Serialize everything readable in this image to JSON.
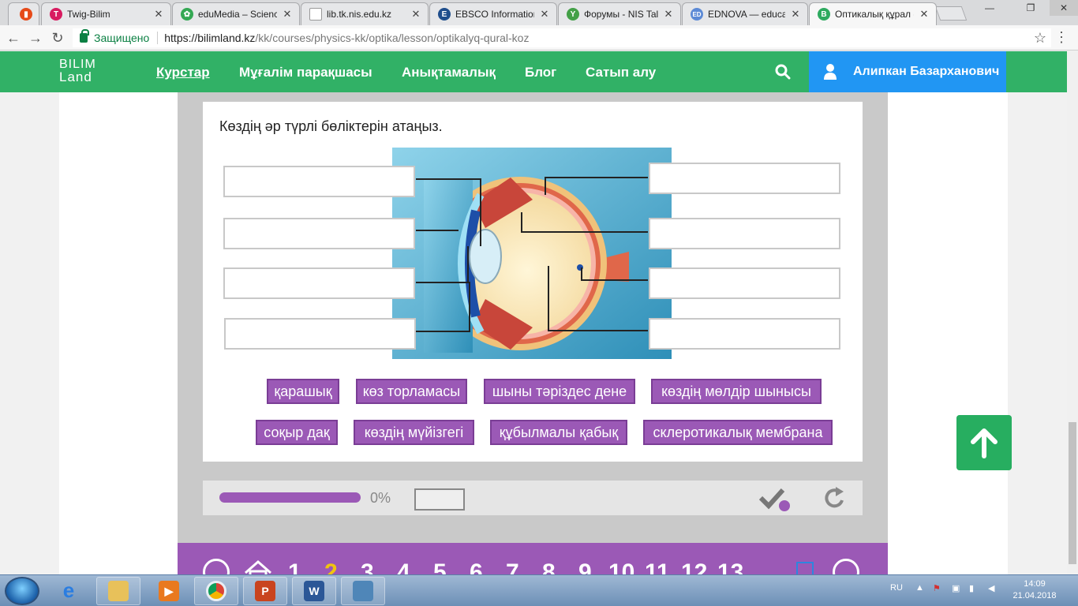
{
  "browser": {
    "tabs": [
      {
        "title": "Twig-Bilim",
        "icon": "twig-icon",
        "color": "#d81b60"
      },
      {
        "title": "eduMedia – Science",
        "icon": "edumedia-icon",
        "color": "#34a853"
      },
      {
        "title": "lib.tk.nis.edu.kz",
        "icon": "page-icon",
        "color": "#9e9e9e"
      },
      {
        "title": "EBSCO Information",
        "icon": "ebsco-icon",
        "color": "#1f4e8c"
      },
      {
        "title": "Форумы - NIS Tald",
        "icon": "forum-icon",
        "color": "#43a047"
      },
      {
        "title": "EDNOVA — educat",
        "icon": "ednova-icon",
        "color": "#5c8ad6"
      },
      {
        "title": "Оптикалық құрал - ",
        "icon": "bilimland-icon",
        "color": "#2eaa5f"
      }
    ],
    "address": {
      "secure_label": "Защищено",
      "url_host": "https://bilimland.kz",
      "url_path": "/kk/courses/physics-kk/optika/lesson/optikalyq-qural-koz"
    }
  },
  "site": {
    "logo_line1": "BILIM",
    "logo_line2": "Land",
    "nav": [
      "Курстар",
      "Мұғалім парақшасы",
      "Анықтамалық",
      "Блог",
      "Сатып алу"
    ],
    "user_name": "Алипкан Базарханович",
    "brand_color": "#31b166"
  },
  "exercise": {
    "question": "Көздің әр түрлі бөліктерін атаңыз.",
    "chips_row1": [
      "қарашық",
      "көз торламасы",
      "шыны тәріздес дене",
      "көздің мөлдір шынысы"
    ],
    "chips_row2": [
      "соқыр дақ",
      "көздің мүйізгегі",
      "құбылмалы қабық",
      "склеротикалық мембрана"
    ],
    "chip_color": "#9b59b6"
  },
  "progress": {
    "percent_text": "0%",
    "fraction": 0
  },
  "pager": {
    "pages": [
      "1",
      "2",
      "3",
      "4",
      "5",
      "6",
      "7",
      "8",
      "9",
      "10",
      "11",
      "12",
      "13"
    ],
    "current": "2"
  },
  "taskbar": {
    "lang": "RU",
    "time": "14:09",
    "date": "21.04.2018"
  }
}
